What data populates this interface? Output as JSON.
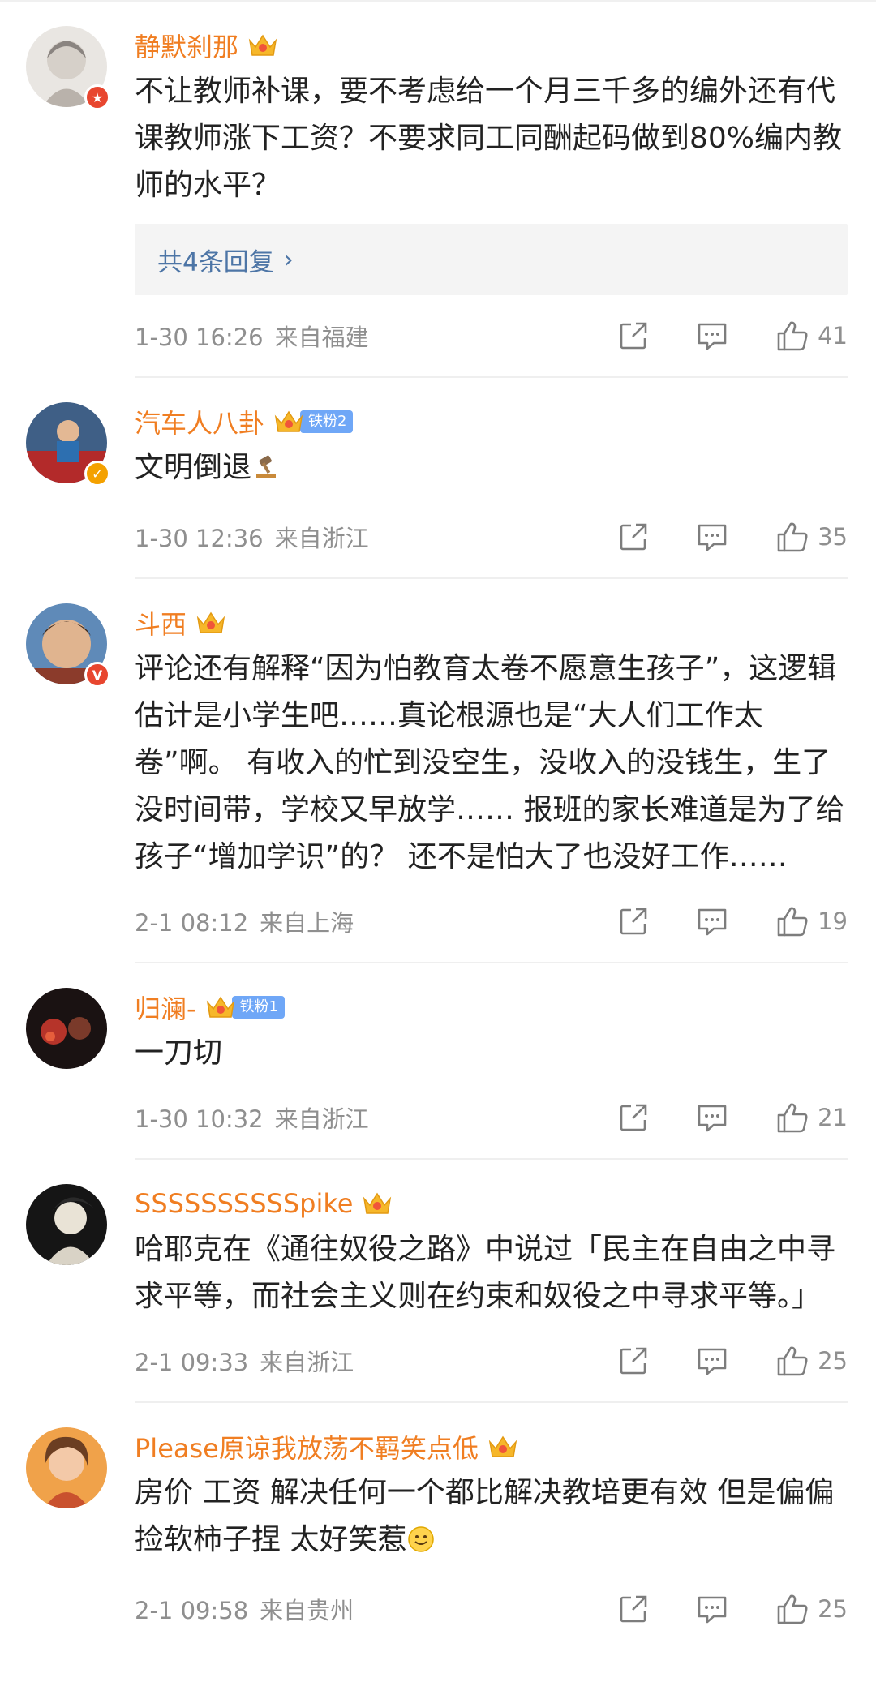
{
  "comments": [
    {
      "username": "静默刹那",
      "text": "不让教师补课，要不考虑给一个月三千多的编外还有代课教师涨下工资？不要求同工同酬起码做到80%编内教师的水平？",
      "reply_label": "共4条回复",
      "time": "1-30 16:26",
      "location": "来自福建",
      "likes": "41"
    },
    {
      "username": "汽车人八卦",
      "fan_badge": "铁粉2",
      "text": "文明倒退",
      "time": "1-30 12:36",
      "location": "来自浙江",
      "likes": "35"
    },
    {
      "username": "斗西",
      "text": "评论还有解释“因为怕教育太卷不愿意生孩子”，这逻辑估计是小学生吧……真论根源也是“大人们工作太卷”啊。 有收入的忙到没空生，没收入的没钱生，生了没时间带，学校又早放学…… 报班的家长难道是为了给孩子“增加学识”的？ 还不是怕大了也没好工作……",
      "time": "2-1 08:12",
      "location": "来自上海",
      "likes": "19"
    },
    {
      "username": "归澜-",
      "fan_badge": "铁粉1",
      "text": "一刀切",
      "time": "1-30 10:32",
      "location": "来自浙江",
      "likes": "21"
    },
    {
      "username": "SSSSSSSSSSpike",
      "text": "哈耶克在《通往奴役之路》中说过「民主在自由之中寻求平等，而社会主义则在约束和奴役之中寻求平等。」",
      "time": "2-1 09:33",
      "location": "来自浙江",
      "likes": "25"
    },
    {
      "username": "Please原谅我放荡不羁笑点低",
      "text": "房价  工资  解决任何一个都比解决教培更有效  但是偏偏捡软柿子捏  太好笑惹",
      "time": "2-1 09:58",
      "location": "来自贵州",
      "likes": "25"
    }
  ],
  "icons": {
    "share": "share-icon",
    "comment": "comment-icon",
    "like": "thumbs-up-icon",
    "crown": "crown-icon"
  },
  "colors": {
    "username": "#f07e22",
    "reply_link": "#4d75a6",
    "meta": "#8f8f8f",
    "fan_badge": "#6fa7f7",
    "verified_orange": "#f4a100",
    "verified_red": "#e8462f"
  }
}
